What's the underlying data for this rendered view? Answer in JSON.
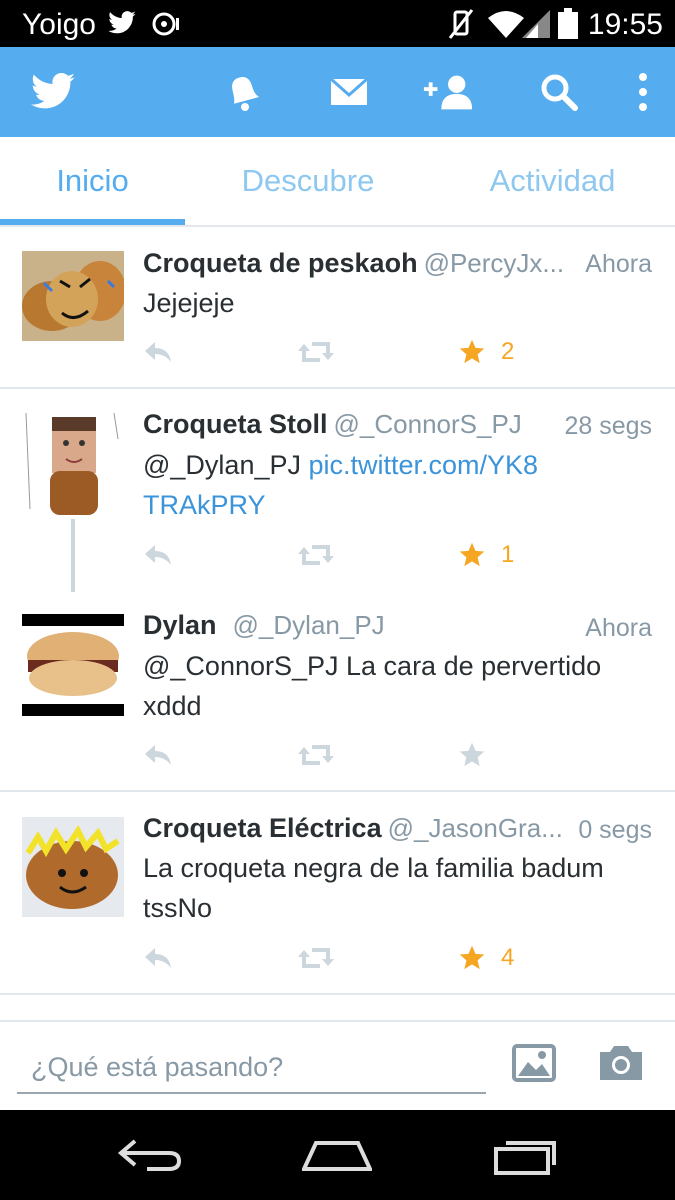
{
  "status_bar": {
    "carrier": "Yoigo",
    "time": "19:55"
  },
  "tabs": [
    {
      "label": "Inicio",
      "active": true
    },
    {
      "label": "Descubre",
      "active": false
    },
    {
      "label": "Actividad",
      "active": false
    }
  ],
  "tweets": [
    {
      "name": "Croqueta de peskaoh",
      "handle": "@PercyJx...",
      "time": "Ahora",
      "text": "Jejejeje",
      "link": "",
      "favorites": "2",
      "favorited": true
    },
    {
      "name": "Croqueta Stoll",
      "handle": "@_ConnorS_PJ",
      "time": "28 segs",
      "text": "@_Dylan_PJ ",
      "link": "pic.twitter.com/YK8TRAkPRY",
      "favorites": "1",
      "favorited": true
    },
    {
      "name": "Dylan",
      "handle": "@_Dylan_PJ",
      "time": "Ahora",
      "text": "@_ConnorS_PJ La cara de pervertido xddd",
      "link": "",
      "favorites": "",
      "favorited": false
    },
    {
      "name": "Croqueta Eléctrica",
      "handle": "@_JasonGra...",
      "time": "0 segs",
      "text": "La croqueta negra de la familia badum tssNo",
      "link": "",
      "favorites": "4",
      "favorited": true
    }
  ],
  "compose": {
    "placeholder": "¿Qué está pasando?"
  },
  "colors": {
    "brand": "#55acee",
    "favorite": "#f5a623",
    "action_gray": "#ccd6dd"
  }
}
